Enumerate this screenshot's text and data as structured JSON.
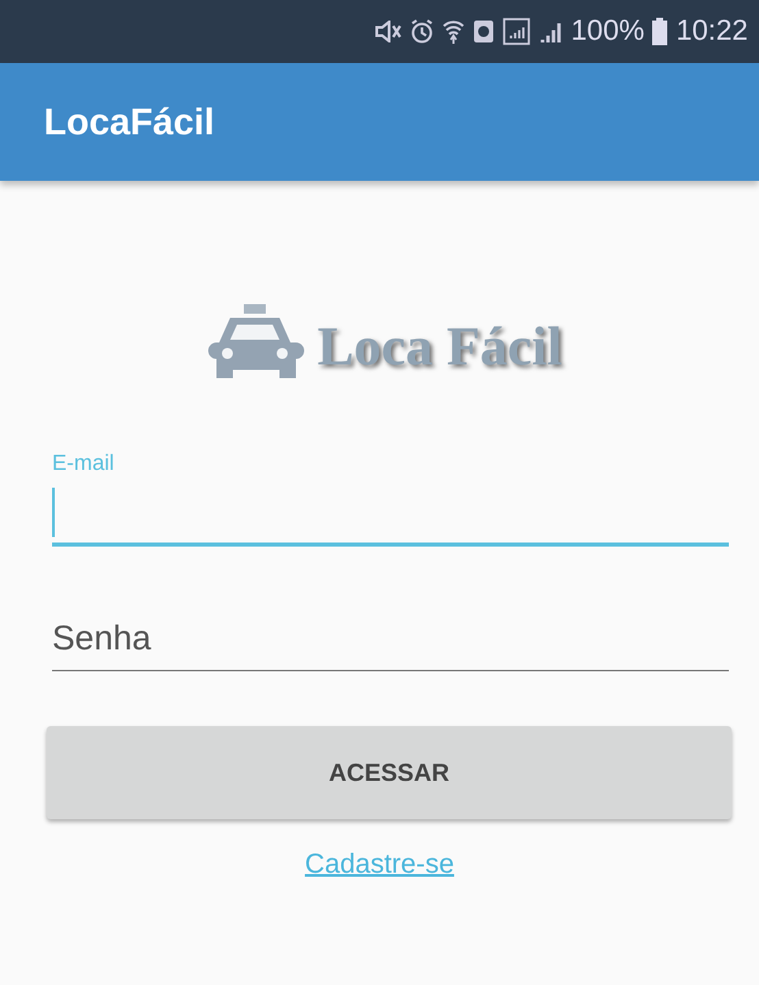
{
  "status_bar": {
    "battery": "100%",
    "time": "10:22"
  },
  "app_bar": {
    "title": "LocaFácil"
  },
  "logo": {
    "text": "Loca Fácil"
  },
  "email": {
    "label": "E-mail",
    "focused": true
  },
  "password": {
    "placeholder": "Senha",
    "focused": false
  },
  "login_button": "ACESSAR",
  "signup_link": "Cadastre-se"
}
